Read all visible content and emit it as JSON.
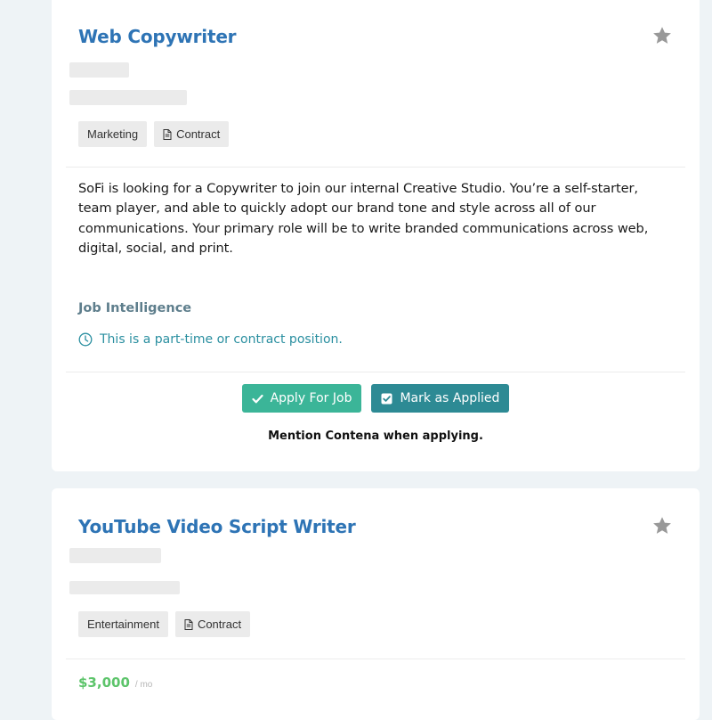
{
  "jobs": [
    {
      "title": "Web Copywriter",
      "tags": [
        {
          "label": "Marketing"
        },
        {
          "label": "Contract",
          "icon": "document-icon"
        }
      ],
      "description": "SoFi is looking for a Copywriter to join our internal Creative Studio. You’re a self-starter, team player, and able to quickly adopt our brand tone and style across all of our communications. Your primary role will be to write branded communications across web, digital, social, and print.",
      "job_intelligence": {
        "heading": "Job Intelligence",
        "items": [
          {
            "icon": "clock-icon",
            "text": "This is a part-time or contract position."
          }
        ]
      },
      "actions": {
        "apply_label": "Apply For Job",
        "mark_applied_label": "Mark as Applied"
      },
      "mention": "Mention Contena when applying."
    },
    {
      "title": "YouTube Video Script Writer",
      "tags": [
        {
          "label": "Entertainment"
        },
        {
          "label": "Contract",
          "icon": "document-icon"
        }
      ],
      "salary": {
        "amount": "$3,000",
        "period": "/ mo"
      }
    }
  ],
  "icons": {
    "favorite": "star-icon",
    "apply": "check-icon",
    "mark_applied": "checkbox-checked-icon"
  },
  "colors": {
    "page_background": "#eef3f6",
    "title_blue": "#2e74b5",
    "apply_button": "#3bb598",
    "mark_applied_button": "#2d8a94",
    "intel_teal": "#2a8fa0",
    "salary_green": "#5cc46a"
  }
}
